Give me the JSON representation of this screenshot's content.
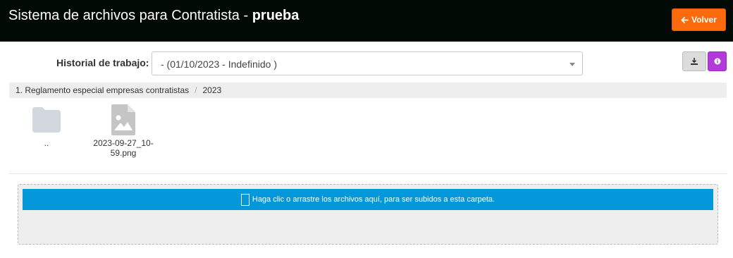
{
  "header": {
    "title_prefix": "Sistema de archivos para Contratista - ",
    "title_bold": "prueba",
    "back_button_label": "Volver",
    "back_button_icon": "arrow-left-icon"
  },
  "history": {
    "label": "Historial de trabajo:",
    "selected": "- (01/10/2023 - Indefinido )"
  },
  "toolbar": {
    "download_icon": "download-icon",
    "info_icon": "info-icon"
  },
  "breadcrumb": {
    "items": [
      "1. Reglamento especial empresas contratistas",
      "2023"
    ],
    "separator": "/"
  },
  "files": [
    {
      "name": "..",
      "type": "folder",
      "icon": "folder-icon"
    },
    {
      "name": "2023-09-27_10-59.png",
      "type": "image",
      "icon": "image-file-icon"
    }
  ],
  "dropzone": {
    "text": "Haga clic o arrastre los archivos aquí, para ser subidos a esta carpeta."
  },
  "colors": {
    "header_bg": "#010a05",
    "back_button": "#fb6b0d",
    "info_button": "#b23ad8",
    "dropzone_bar": "#0497d9"
  }
}
